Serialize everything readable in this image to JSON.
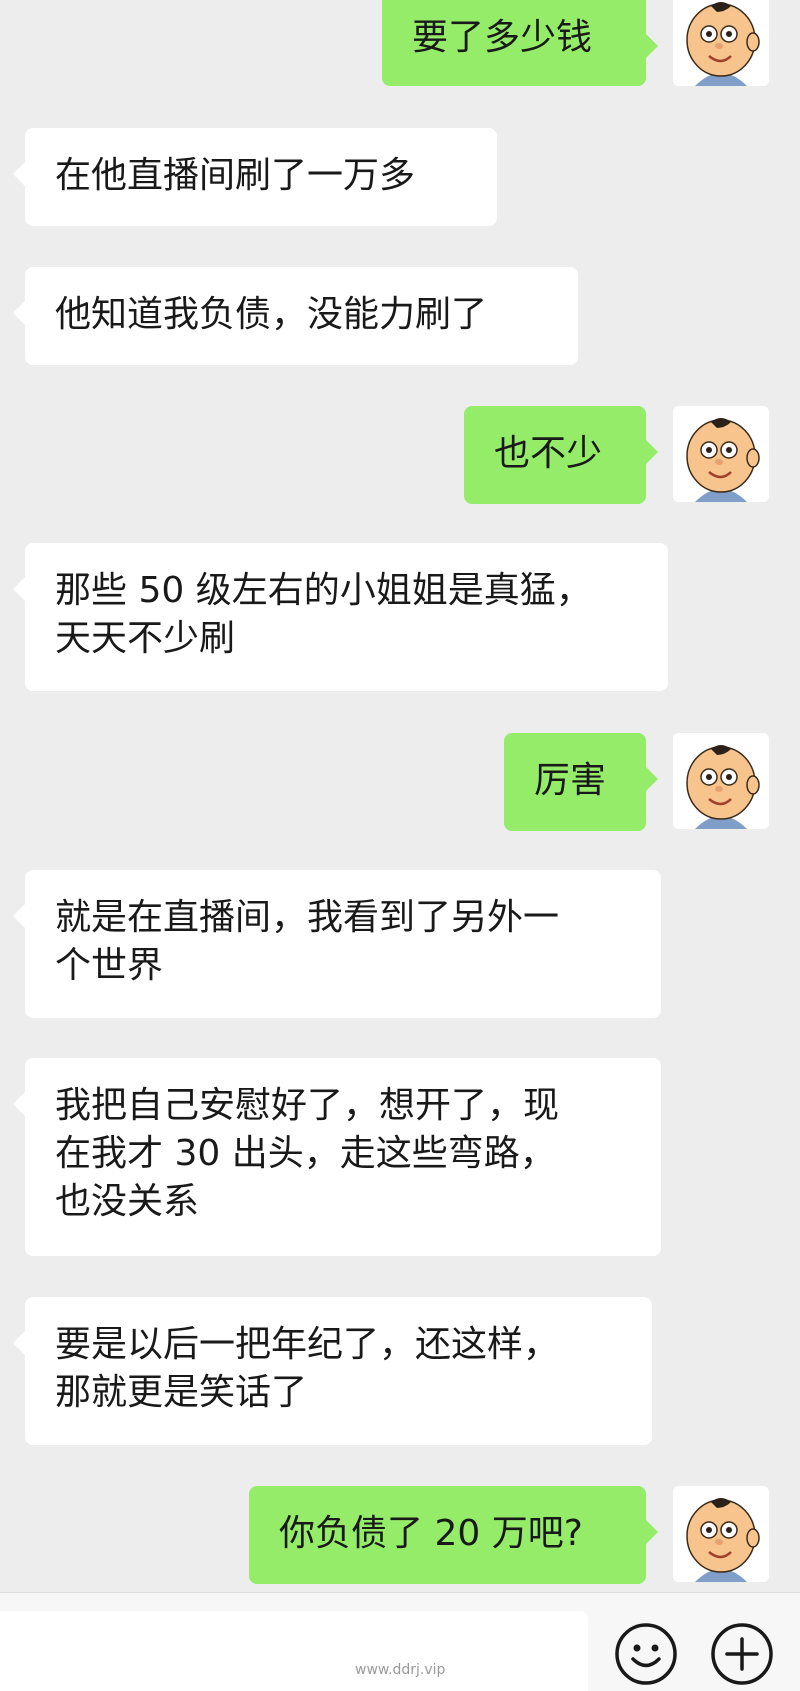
{
  "messages": [
    {
      "side": "out",
      "text": "要了多少钱"
    },
    {
      "side": "in",
      "text": "在他直播间刷了一万多"
    },
    {
      "side": "in",
      "text": "他知道我负债，没能力刷了"
    },
    {
      "side": "out",
      "text": "也不少"
    },
    {
      "side": "in",
      "text": "那些 50 级左右的小姐姐是真猛，\n天天不少刷"
    },
    {
      "side": "out",
      "text": "厉害"
    },
    {
      "side": "in",
      "text": "就是在直播间，我看到了另外一\n个世界"
    },
    {
      "side": "in",
      "text": "我把自己安慰好了，想开了，现\n在我才 30 出头，走这些弯路，\n也没关系"
    },
    {
      "side": "in",
      "text": "要是以后一把年纪了，还这样，\n那就更是笑话了"
    },
    {
      "side": "out",
      "text": "你负债了 20 万吧?"
    }
  ],
  "avatar_icon": "cartoon-boy-avatar-icon",
  "input_bar": {
    "emoji_icon": "emoji-icon",
    "plus_icon": "plus-icon"
  },
  "watermark": "www.ddrj.vip",
  "colors": {
    "background": "#ededed",
    "incoming_bubble": "#ffffff",
    "outgoing_bubble": "#95ec69",
    "text": "#191919"
  }
}
